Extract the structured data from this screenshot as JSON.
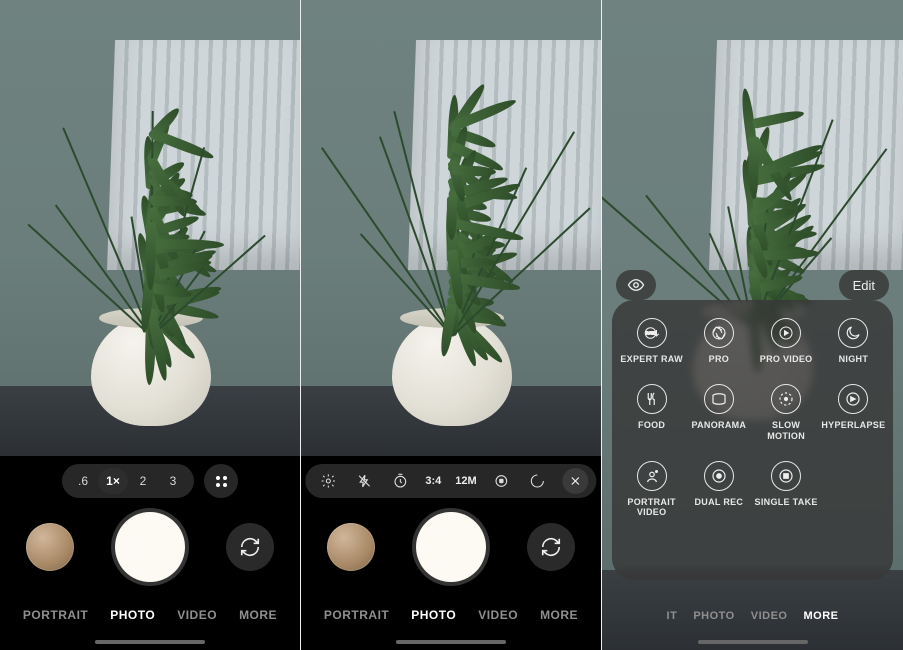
{
  "status": {
    "resolution": "12M"
  },
  "zoom": {
    "levels": [
      ".6",
      "1×",
      "2",
      "3"
    ],
    "active_index": 1
  },
  "modes": {
    "items": [
      "PORTRAIT",
      "PHOTO",
      "VIDEO",
      "MORE"
    ]
  },
  "quick_settings": {
    "aspect": "3:4",
    "resolution": "12M"
  },
  "more_panel": {
    "edit_label": "Edit",
    "tiles": [
      {
        "label": "EXPERT RAW",
        "icon": "raw"
      },
      {
        "label": "PRO",
        "icon": "aperture"
      },
      {
        "label": "PRO VIDEO",
        "icon": "play"
      },
      {
        "label": "NIGHT",
        "icon": "moon"
      },
      {
        "label": "FOOD",
        "icon": "food"
      },
      {
        "label": "PANORAMA",
        "icon": "panorama"
      },
      {
        "label": "SLOW\nMOTION",
        "icon": "slowmo"
      },
      {
        "label": "HYPERLAPSE",
        "icon": "hyperlapse"
      },
      {
        "label": "PORTRAIT\nVIDEO",
        "icon": "portraitvideo"
      },
      {
        "label": "DUAL REC",
        "icon": "dualrec"
      },
      {
        "label": "SINGLE TAKE",
        "icon": "singletake"
      }
    ]
  },
  "screens": {
    "s1_active_mode": 1,
    "s2_active_mode": 1,
    "s3_active_mode": 3
  },
  "modes_short": {
    "items": [
      "IT",
      "PHOTO",
      "VIDEO",
      "MORE"
    ]
  }
}
